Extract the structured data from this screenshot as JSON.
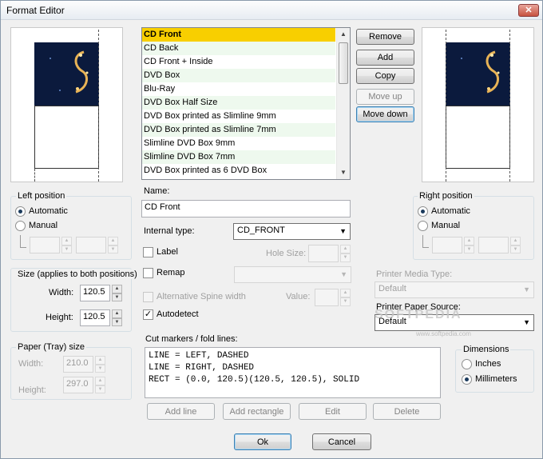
{
  "window": {
    "title": "Format Editor"
  },
  "formats": {
    "items": [
      "CD Front",
      "CD Back",
      "CD Front + Inside",
      "DVD Box",
      "Blu-Ray",
      "DVD Box Half Size",
      "DVD Box printed as Slimline 9mm",
      "DVD Box printed as Slimline 7mm",
      "Slimline DVD Box 9mm",
      "Slimline DVD Box 7mm",
      "DVD Box printed as 6 DVD Box"
    ],
    "selected_index": 0
  },
  "list_buttons": {
    "remove": "Remove",
    "add": "Add",
    "copy": "Copy",
    "move_up": "Move up",
    "move_down": "Move down"
  },
  "left_position": {
    "title": "Left position",
    "automatic": "Automatic",
    "manual": "Manual",
    "selected": "Automatic"
  },
  "right_position": {
    "title": "Right position",
    "automatic": "Automatic",
    "manual": "Manual",
    "selected": "Automatic"
  },
  "size": {
    "title": "Size (applies to both positions)",
    "width_label": "Width:",
    "width_value": "120.5",
    "height_label": "Height:",
    "height_value": "120.5"
  },
  "paper": {
    "title": "Paper (Tray) size",
    "width_label": "Width:",
    "width_value": "210.0",
    "height_label": "Height:",
    "height_value": "297.0"
  },
  "name": {
    "label": "Name:",
    "value": "CD Front"
  },
  "internal_type": {
    "label": "Internal type:",
    "value": "CD_FRONT"
  },
  "label_check": {
    "label": "Label",
    "checked": false
  },
  "hole_size": {
    "label": "Hole Size:",
    "value": ""
  },
  "remap": {
    "label": "Remap",
    "checked": false,
    "value": ""
  },
  "alt_spine": {
    "label": "Alternative Spine width",
    "checked": false
  },
  "spine_value": {
    "label": "Value:",
    "value": ""
  },
  "autodetect": {
    "label": "Autodetect",
    "checked": true
  },
  "printer_media": {
    "label": "Printer Media Type:",
    "value": "Default"
  },
  "printer_paper": {
    "label": "Printer Paper Source:",
    "value": "Default"
  },
  "cut_markers": {
    "label": "Cut markers / fold lines:",
    "lines": [
      "LINE = LEFT, DASHED",
      "LINE = RIGHT, DASHED",
      "RECT = (0.0, 120.5)(120.5, 120.5), SOLID"
    ]
  },
  "marker_buttons": {
    "add_line": "Add line",
    "add_rectangle": "Add rectangle",
    "edit": "Edit",
    "delete": "Delete"
  },
  "dimensions": {
    "title": "Dimensions",
    "inches": "Inches",
    "millimeters": "Millimeters",
    "selected": "Millimeters"
  },
  "dialog_buttons": {
    "ok": "Ok",
    "cancel": "Cancel"
  },
  "watermark": {
    "text": "SOFTPEDIA",
    "url": "www.softpedia.com"
  },
  "icons": {
    "close": "close-icon",
    "spin_up": "up-arrow-icon",
    "spin_down": "down-arrow-icon"
  }
}
